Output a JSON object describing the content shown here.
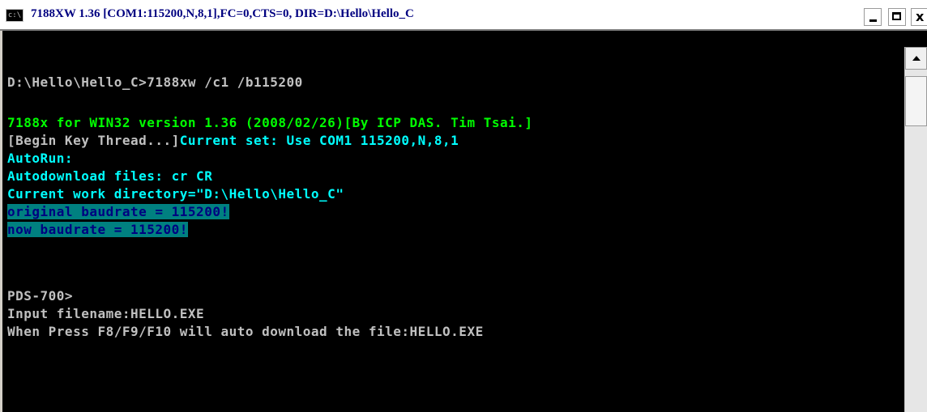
{
  "window": {
    "icon_text": "c:\\",
    "title": "7188XW 1.36 [COM1:115200,N,8,1],FC=0,CTS=0, DIR=D:\\Hello\\Hello_C",
    "minimize_glyph": "",
    "maximize_glyph": "",
    "close_glyph": "x"
  },
  "console": {
    "lines": [
      "D:\\Hello\\Hello_C>7188xw /c1 /b115200",
      "7188x for WIN32 version 1.36 (2008/02/26)[By ICP DAS. Tim Tsai.]",
      "[Begin Key Thread...]",
      "Current set: Use COM1 115200,N,8,1",
      "AutoRun:",
      "Autodownload files: cr CR",
      "Current work directory=\"D:\\Hello\\Hello_C\"",
      "original baudrate = 115200!",
      "now baudrate = 115200!",
      "PDS-700>",
      "Input filename:HELLO.EXE",
      "When Press F8/F9/F10 will auto download the file:HELLO.EXE"
    ]
  },
  "colors": {
    "console_bg": "#000000",
    "default_text": "#c0c0c0",
    "green_text": "#00ff00",
    "cyan_text": "#00ffff",
    "highlight_bg": "#008080",
    "highlight_text": "#000080",
    "title_text": "#000080"
  }
}
